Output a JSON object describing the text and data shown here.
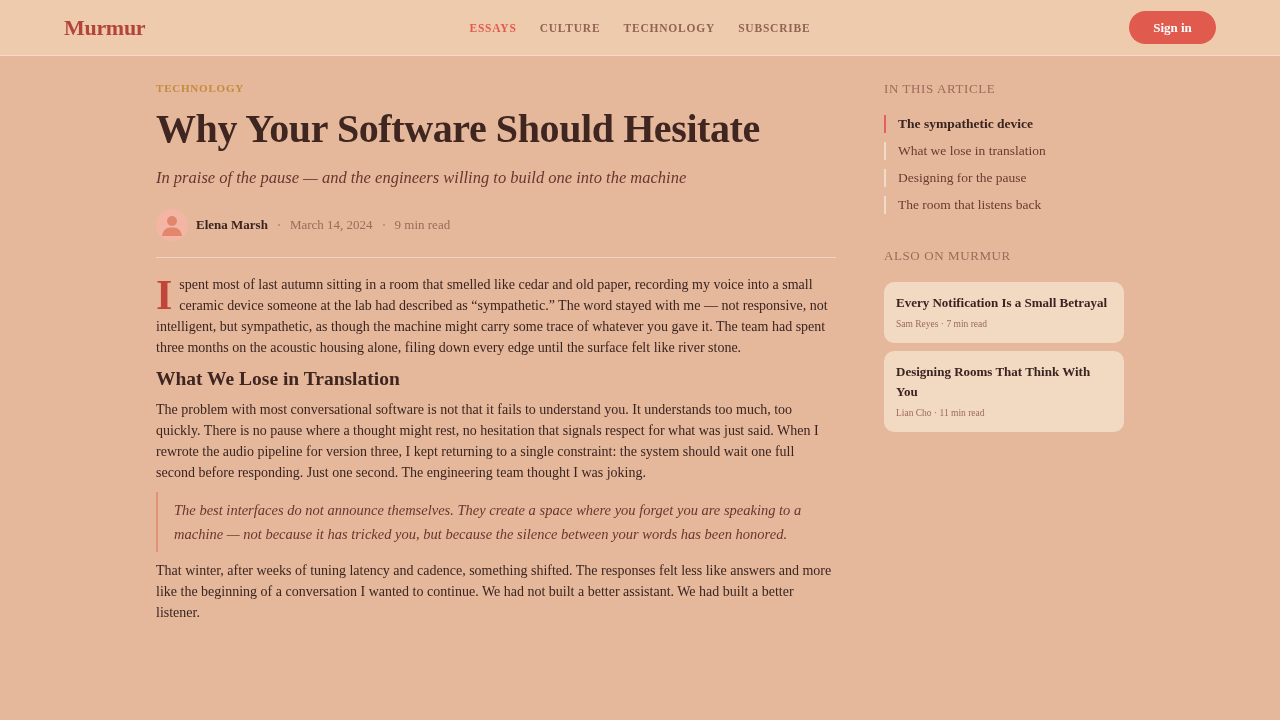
{
  "header": {
    "logo": "Murmur",
    "nav": [
      {
        "label": "ESSAYS",
        "selected": true
      },
      {
        "label": "CULTURE",
        "selected": false
      },
      {
        "label": "TECHNOLOGY",
        "selected": false
      },
      {
        "label": "SUBSCRIBE",
        "selected": false
      }
    ],
    "sign_in": "Sign in"
  },
  "article": {
    "category": "TECHNOLOGY",
    "title": "Why Your Software Should Hesitate",
    "subtitle": "In praise of the pause — and the engineers willing to build one into the machine",
    "byline": {
      "author": "Elena Marsh",
      "date": "March 14, 2024",
      "read_time": "9 min read"
    },
    "body": [
      {
        "kind": "paragraph",
        "drop_cap": "I",
        "text": "spent most of last autumn sitting in a room that smelled like cedar and old paper, recording my voice into a small ceramic device someone at the lab had described as “sympathetic.” The word stayed with me — not responsive, not intelligent, but sympathetic, as though the machine might carry some trace of whatever you gave it. The team had spent three months on the acoustic housing alone, filing down every edge until the surface felt like river stone."
      },
      {
        "kind": "heading",
        "text": "What We Lose in Translation"
      },
      {
        "kind": "paragraph",
        "text": "The problem with most conversational software is not that it fails to understand you. It understands too much, too quickly. There is no pause where a thought might rest, no hesitation that signals respect for what was just said. When I rewrote the audio pipeline for version three, I kept returning to a single constraint: the system should wait one full second before responding. Just one second. The engineering team thought I was joking."
      },
      {
        "kind": "quote",
        "text": "The best interfaces do not announce themselves. They create a space where you forget you are speaking to a machine — not because it has tricked you, but because the silence between your words has been honored."
      },
      {
        "kind": "paragraph",
        "text": "That winter, after weeks of tuning latency and cadence, something shifted. The responses felt less like answers and more like the beginning of a conversation I wanted to continue. We had not built a better assistant. We had built a better listener."
      }
    ]
  },
  "sidebar": {
    "toc": {
      "title": "IN THIS ARTICLE",
      "items": [
        {
          "label": "The sympathetic device",
          "selected": true
        },
        {
          "label": "What we lose in translation",
          "selected": false
        },
        {
          "label": "Designing for the pause",
          "selected": false
        },
        {
          "label": "The room that listens back",
          "selected": false
        }
      ]
    },
    "related": {
      "title": "ALSO ON MURMUR",
      "cards": [
        {
          "title": "Every Notification Is a Small Betrayal",
          "meta": "Sam Reyes · 7 min read"
        },
        {
          "title": "Designing Rooms That Think With You",
          "meta": "Lian Cho · 11 min read"
        }
      ]
    }
  }
}
